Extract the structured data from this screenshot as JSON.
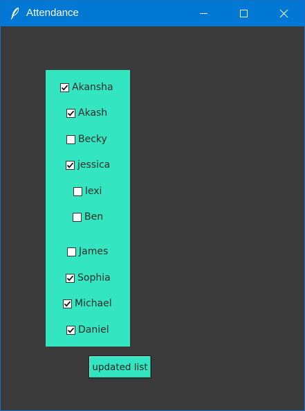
{
  "window": {
    "title": "Attendance",
    "title_icon": "feather-icon",
    "controls": [
      "minimize-icon",
      "maximize-icon",
      "close-icon"
    ]
  },
  "attendance": {
    "students": [
      {
        "name": "Akansha",
        "checked": true
      },
      {
        "name": "Akash",
        "checked": true
      },
      {
        "name": "Becky",
        "checked": false
      },
      {
        "name": "jessica",
        "checked": true
      },
      {
        "name": "lexi",
        "checked": false
      },
      {
        "name": "Ben",
        "checked": false
      },
      {
        "name": "James",
        "checked": false
      },
      {
        "name": "Sophia",
        "checked": true
      },
      {
        "name": "Michael",
        "checked": true
      },
      {
        "name": "Daniel",
        "checked": true
      }
    ],
    "update_button_label": "updated list"
  },
  "colors": {
    "titlebar": "#0078d4",
    "background": "#3a3a3a",
    "panel": "#33e5c0"
  }
}
